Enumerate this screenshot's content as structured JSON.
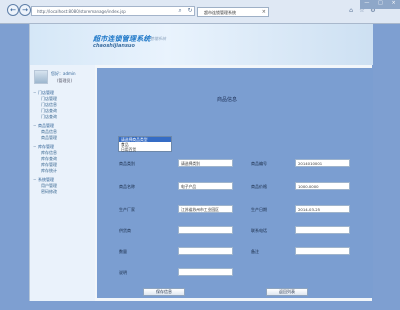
{
  "browser": {
    "address": "http://localhost:8080/storemanage/index.jsp",
    "tab_title": "超市连锁管理系统",
    "window_controls": [
      "—",
      "□",
      "×"
    ]
  },
  "header": {
    "brand": "超市连锁管理系统",
    "brand_sub": "管理系统",
    "brand_en": "chaoshijiansuo"
  },
  "user": {
    "name": "您好：admin",
    "role": "(管理员)"
  },
  "sidebar": {
    "groups": [
      {
        "title": "门店管理",
        "items": [
          "门店管理",
          "门店信息",
          "门店查询",
          "门店查询"
        ]
      },
      {
        "title": "商品管理",
        "items": [
          "商品信息",
          "商品管理"
        ]
      },
      {
        "title": "库存管理",
        "items": [
          "库存信息",
          "库存查询",
          "库存管理",
          "库存统计"
        ]
      },
      {
        "title": "系统管理",
        "items": [
          "用户管理",
          "密码修改"
        ]
      }
    ]
  },
  "form": {
    "title": "商品信息",
    "dropdown": {
      "options": [
        "请选择商品类型",
        "食品",
        "日用百货"
      ],
      "selected_index": 0
    },
    "fields": {
      "goods_category_label": "商品类别",
      "goods_category_value": "请选择类别",
      "goods_code_label": "商品编号",
      "goods_code_value": "2014010001",
      "goods_name_label": "商品名称",
      "goods_name_value": "电子产品",
      "goods_price_label": "商品价格",
      "goods_price_value": "1000.0000",
      "produce_place_label": "生产厂家",
      "produce_place_value": "江苏省苏州市工业园区",
      "produce_date_label": "生产日期",
      "produce_date_value": "2014-03-25",
      "supplier_label": "供货商",
      "supplier_value": "",
      "supplier_phone_label": "联系电话",
      "supplier_phone_value": "",
      "count_label": "数量",
      "count_value": "",
      "remark_label": "备注",
      "remark_value": "",
      "memo_label": "说明",
      "memo_value": ""
    },
    "buttons": {
      "save": "保存信息",
      "back": "返回列表"
    }
  }
}
